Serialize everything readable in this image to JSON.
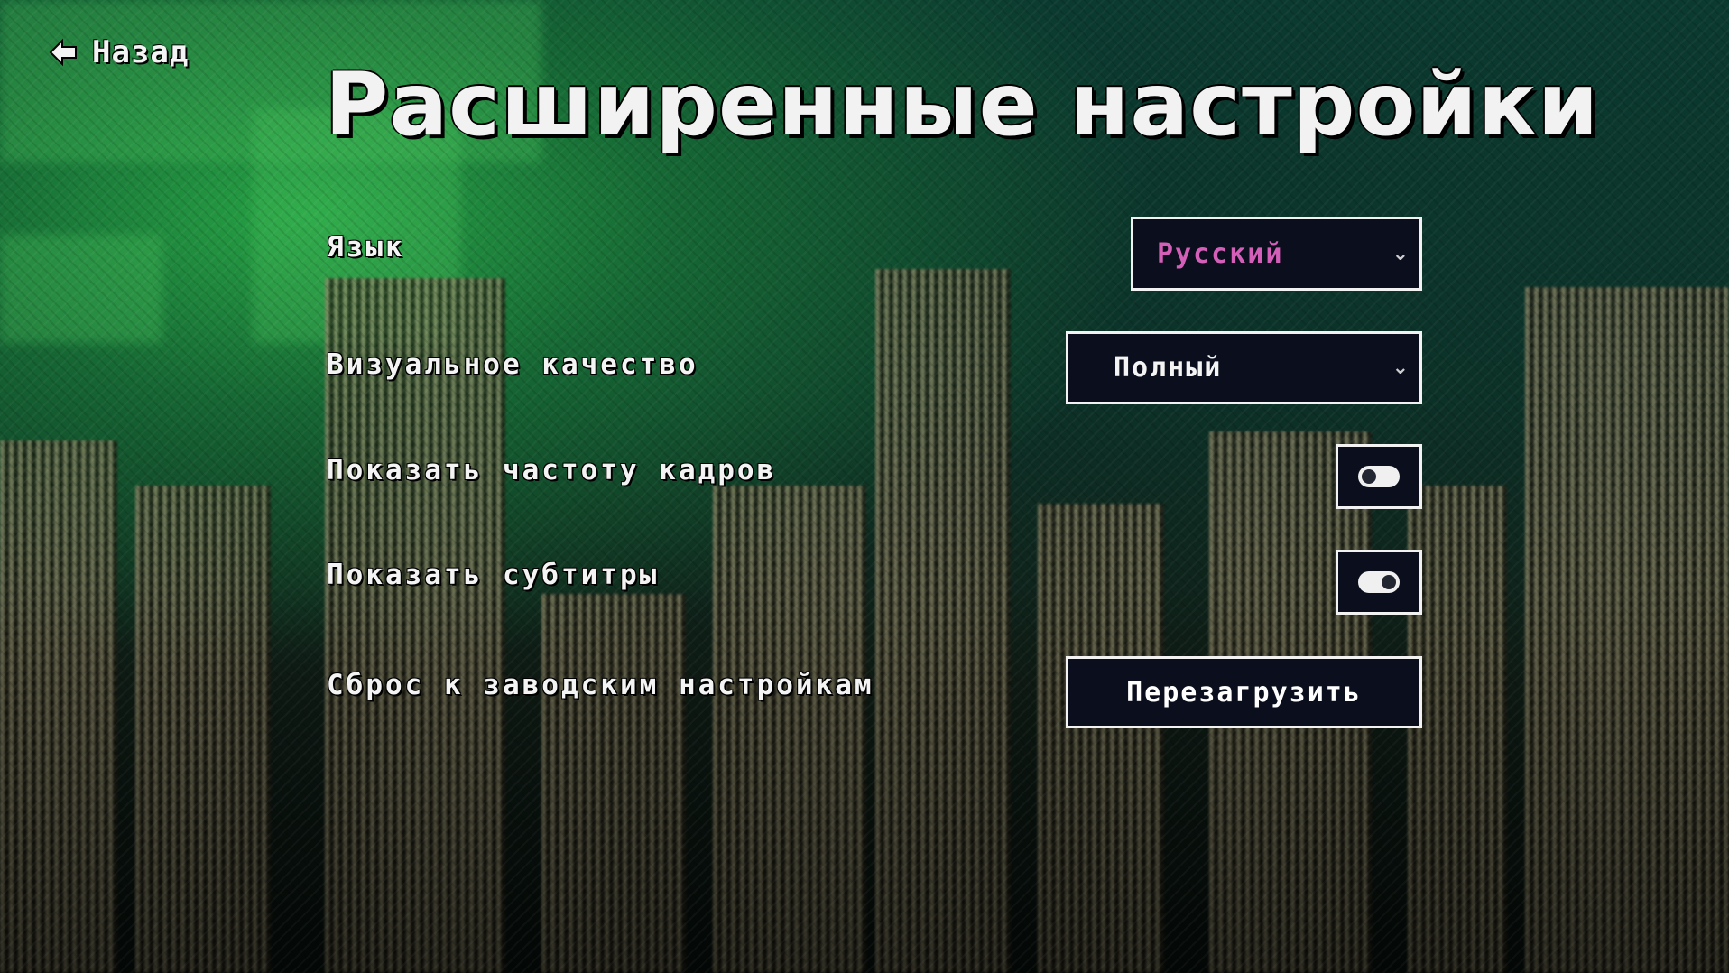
{
  "nav": {
    "back_label": "Назад"
  },
  "page": {
    "title": "Расширенные настройки"
  },
  "settings": {
    "language": {
      "label": "Язык",
      "value": "Русский",
      "value_color": "#d45fb8"
    },
    "visual_quality": {
      "label": "Визуальное качество",
      "value": "Полный"
    },
    "show_fps": {
      "label": "Показать частоту кадров",
      "enabled": false
    },
    "show_subtitles": {
      "label": "Показать субтитры",
      "enabled": true
    },
    "factory_reset": {
      "label": "Сброс к заводским настройкам",
      "button_label": "Перезагрузить"
    }
  },
  "icons": {
    "back": "arrow-left-icon",
    "dropdown": "chevron-down-icon"
  },
  "colors": {
    "control_bg": "#0b0f1d",
    "control_border": "#f2f2f2",
    "text": "#f4f4f4"
  }
}
